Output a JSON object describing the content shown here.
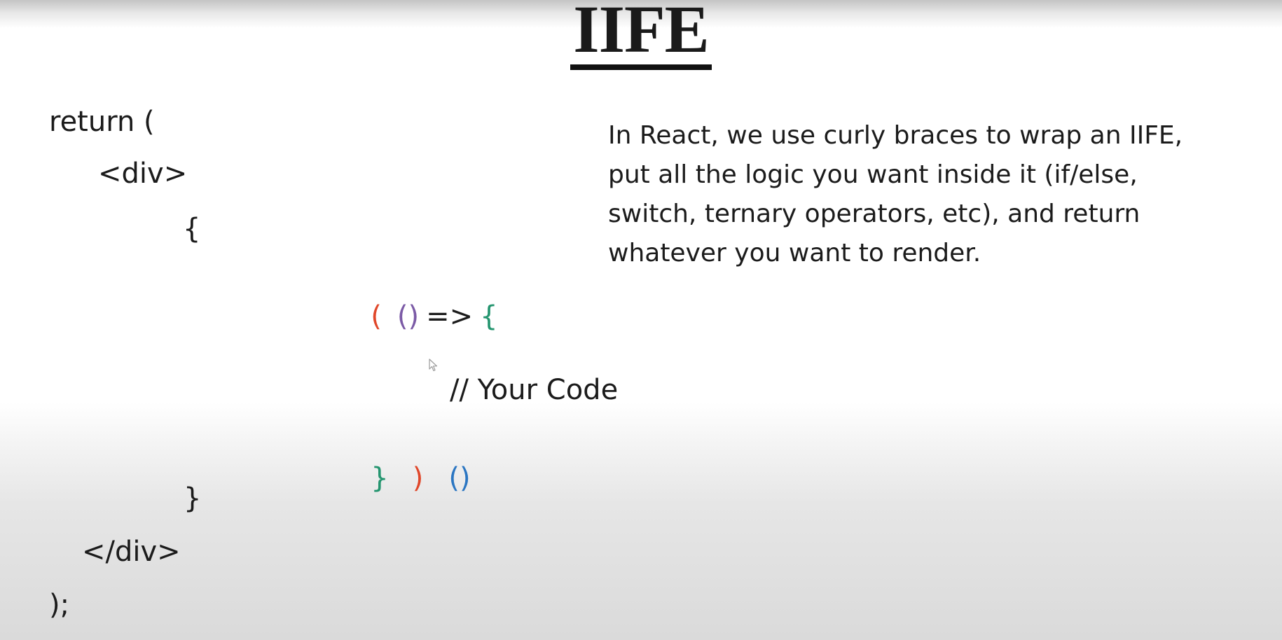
{
  "slide": {
    "title": "IIFE",
    "code": {
      "line1": "return (",
      "line2": "<div>",
      "line3": "{",
      "line4": {
        "paren_open": "(",
        "params": "()",
        "arrow": "=>",
        "brace_open": "{"
      },
      "line5": "// Your Code",
      "line6": {
        "brace_close": "}",
        "paren_close": ")",
        "invoke": "()"
      },
      "line7": "}",
      "line8": "</div>",
      "line9": ");"
    },
    "description": {
      "line1": "In React, we use curly braces to wrap an IIFE,",
      "line2": "put all the logic you want inside it (if/else,",
      "line3": "switch, ternary operators, etc), and return",
      "line4": "whatever you want to render."
    },
    "colors": {
      "paren": "#e0472a",
      "params": "#7b5aa6",
      "brace": "#24956f",
      "invoke": "#2b76c2"
    }
  }
}
